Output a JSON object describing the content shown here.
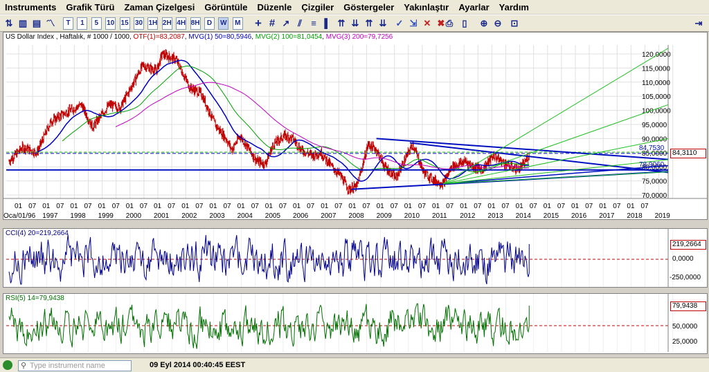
{
  "menu": [
    "Instruments",
    "Grafik Türü",
    "Zaman Çizelgesi",
    "Görüntüle",
    "Düzenle",
    "Çizgiler",
    "Göstergeler",
    "Yakınlaştır",
    "Ayarlar",
    "Yardım"
  ],
  "toolbar": {
    "timeframes": [
      "T",
      "1",
      "5",
      "10",
      "15",
      "30",
      "1H",
      "2H",
      "4H",
      "8H",
      "D",
      "W",
      "M"
    ],
    "selected_timeframe": "W"
  },
  "main_chart": {
    "header_prefix": "US Dollar Index , Haftalık, # 1000 / 1000, ",
    "otf": "OTF(1)=83,2087",
    "mvg1": "MVG(1) 50=80,5946",
    "mvg2": "MVG(2) 100=81,0454",
    "mvg3": "MVG(3) 200=79,7256",
    "price_ticks": [
      "120,0000",
      "115,0000",
      "110,0000",
      "105,0000",
      "100,0000",
      "95,0000",
      "90,0000",
      "85,0000",
      "80,0000",
      "75,0000",
      "70,0000"
    ],
    "level_upper": "84,7530",
    "level_lower": "78,9060",
    "current_price": "84,3110",
    "colors": {
      "price": "#c00000",
      "mvg1": "#0000c0",
      "mvg2": "#00a000",
      "mvg3": "#c000c0",
      "trend": "#0010c0",
      "fan": "#20c020"
    }
  },
  "xaxis": {
    "months": [
      "01",
      "07",
      "01",
      "07",
      "01",
      "07",
      "01",
      "07",
      "01",
      "07",
      "01",
      "07",
      "01",
      "07",
      "01",
      "07",
      "01",
      "07",
      "01",
      "07",
      "01",
      "07",
      "01",
      "07",
      "01",
      "07",
      "01",
      "07",
      "01",
      "07",
      "01",
      "07",
      "01",
      "07",
      "01",
      "07",
      "01",
      "07",
      "01",
      "07",
      "01",
      "07",
      "01",
      "07",
      "01",
      "07"
    ],
    "years": [
      "Oca/01/96",
      "1997",
      "1998",
      "1999",
      "2000",
      "2001",
      "2002",
      "2003",
      "2004",
      "2005",
      "2006",
      "2007",
      "2008",
      "2009",
      "2010",
      "2011",
      "2012",
      "2013",
      "2014",
      "2015",
      "2016",
      "2017",
      "2018",
      "2019"
    ]
  },
  "cci": {
    "title": "CCI(4) 20=219,2664",
    "current": "219,2664",
    "ticks": [
      "0,0000",
      "-250,0000"
    ],
    "color": "#00008b"
  },
  "rsi": {
    "title": "RSI(5) 14=79,9438",
    "current": "79,9438",
    "ticks": [
      "50,0000",
      "25,0000"
    ],
    "color": "#007000"
  },
  "status": {
    "search_placeholder": "Type instrument name",
    "datetime": "09 Eyl 2014 00:40:45 EEST"
  }
}
